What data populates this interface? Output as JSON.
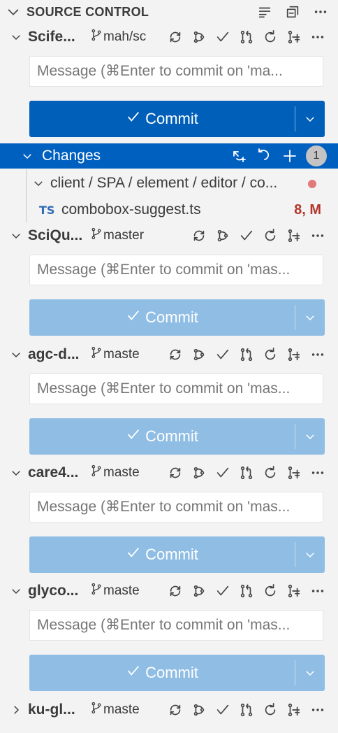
{
  "header": {
    "title": "SOURCE CONTROL"
  },
  "repos": [
    {
      "name": "Scife...",
      "branch": "mah/sc",
      "message_placeholder": "Message (⌘Enter to commit on 'ma...",
      "commit_label": "Commit",
      "expanded": true,
      "active": true
    },
    {
      "name": "SciQu...",
      "branch": "master",
      "message_placeholder": "Message (⌘Enter to commit on 'mas...",
      "commit_label": "Commit",
      "expanded": true,
      "active": false
    },
    {
      "name": "agc-d...",
      "branch": "maste",
      "message_placeholder": "Message (⌘Enter to commit on 'mas...",
      "commit_label": "Commit",
      "expanded": true,
      "active": false
    },
    {
      "name": "care4...",
      "branch": "maste",
      "message_placeholder": "Message (⌘Enter to commit on 'mas...",
      "commit_label": "Commit",
      "expanded": true,
      "active": false
    },
    {
      "name": "glyco...",
      "branch": "maste",
      "message_placeholder": "Message (⌘Enter to commit on 'mas...",
      "commit_label": "Commit",
      "expanded": true,
      "active": false
    },
    {
      "name": "ku-gl...",
      "branch": "maste",
      "expanded": false
    }
  ],
  "changes": {
    "label": "Changes",
    "count": "1",
    "folder": "client / SPA / element / editor / co...",
    "file": {
      "icon_text": "TS",
      "name": "combobox-suggest.ts",
      "status": "8, M"
    }
  },
  "colors": {
    "accent": "#005fb8",
    "selection": "#0060c0",
    "dim_commit": "#8fbde3",
    "modified": "#b3362c"
  }
}
